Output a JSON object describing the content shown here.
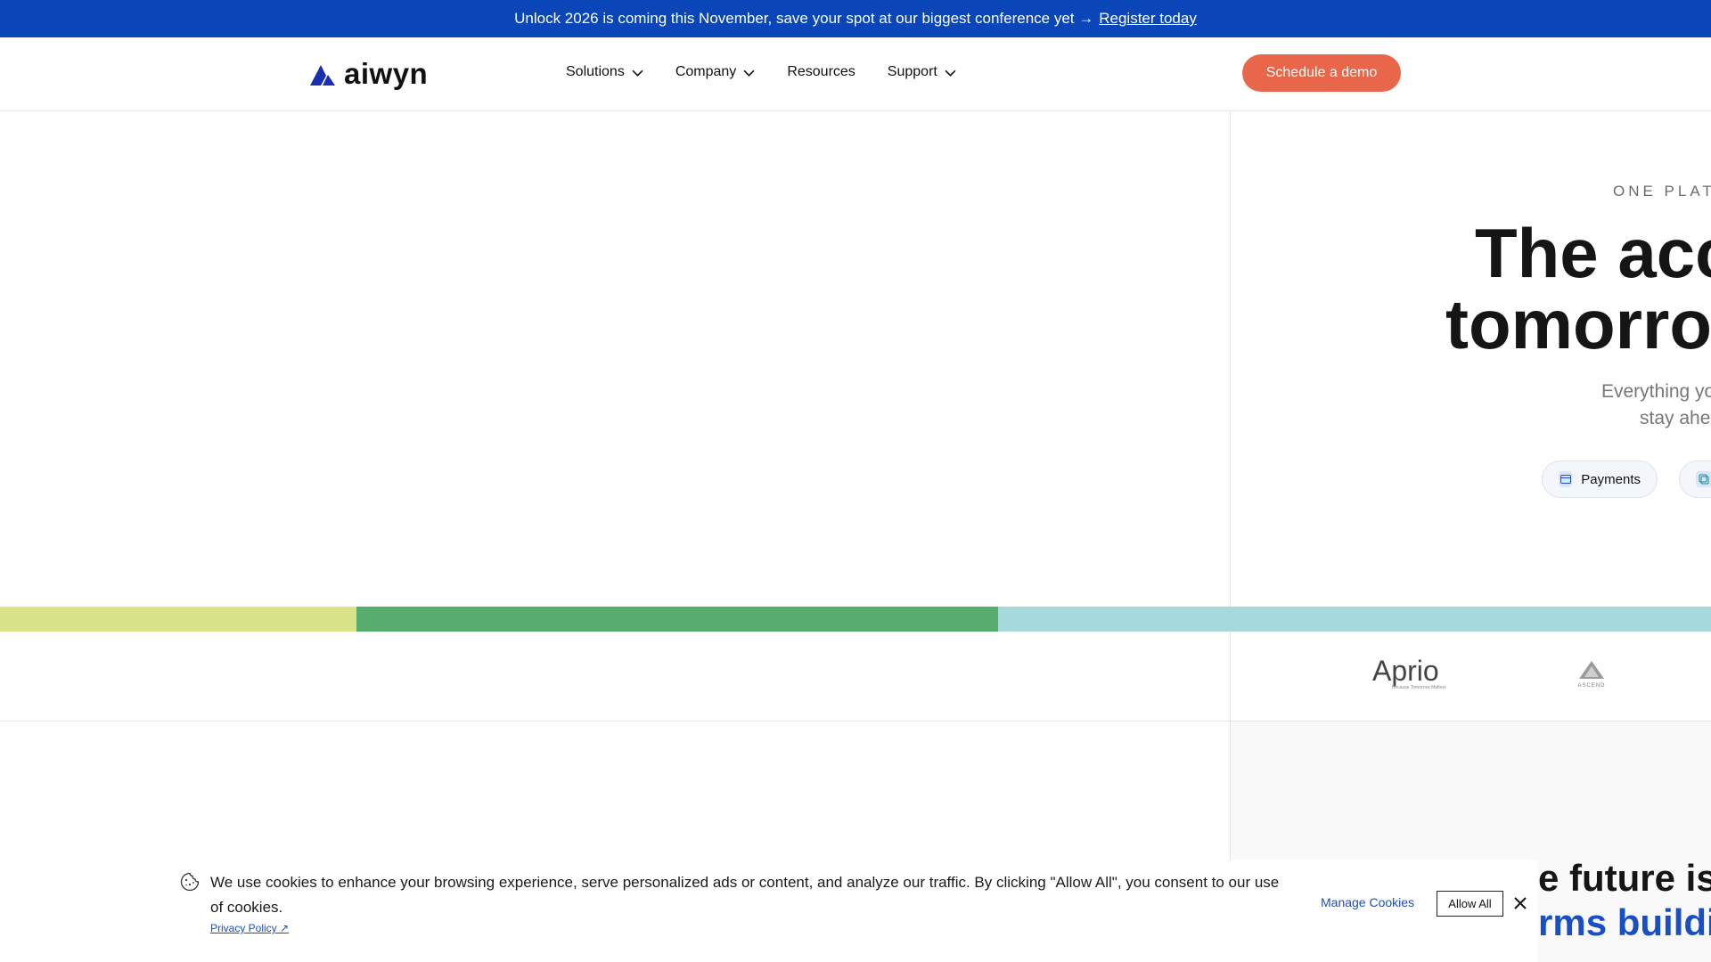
{
  "announcement": {
    "text": "Unlock 2026 is coming this November, save your spot at our biggest conference yet →",
    "link_label": "Register today"
  },
  "header": {
    "logo_text": "aiwyn",
    "nav": [
      {
        "label": "Solutions",
        "has_dropdown": true
      },
      {
        "label": "Company",
        "has_dropdown": true
      },
      {
        "label": "Resources",
        "has_dropdown": false
      },
      {
        "label": "Support",
        "has_dropdown": true
      }
    ],
    "cta_label": "Schedule a demo"
  },
  "hero": {
    "eyebrow": "ONE PLATF",
    "headline_line1": "The acco",
    "headline_line2": "tomorrow",
    "subtext_line1": "Everything yo",
    "subtext_line2": "stay ahea",
    "pills": [
      {
        "label": "Payments",
        "icon": "card-icon"
      },
      {
        "label": "",
        "icon": "document-icon"
      }
    ]
  },
  "logos": {
    "aprio": "Aprio",
    "aprio_tagline": "Because Tomorrow Matters",
    "ascend": "ASCEND"
  },
  "lower": {
    "line1": "e future isn",
    "line2": "rms buildin"
  },
  "cookie": {
    "text": "We use cookies to enhance your browsing experience, serve personalized ads or content, and analyze our traffic. By clicking \"Allow All\", you consent to our use of cookies.",
    "privacy_label": "Privacy Policy ↗",
    "manage_label": "Manage Cookies",
    "allow_label": "Allow All"
  },
  "colors": {
    "announce_bg": "#0a46b8",
    "cta_bg": "#e8664a",
    "band": [
      "#d8e38a",
      "#56ad6e",
      "#a6d9d9"
    ],
    "accent_blue": "#1a4fc4"
  }
}
